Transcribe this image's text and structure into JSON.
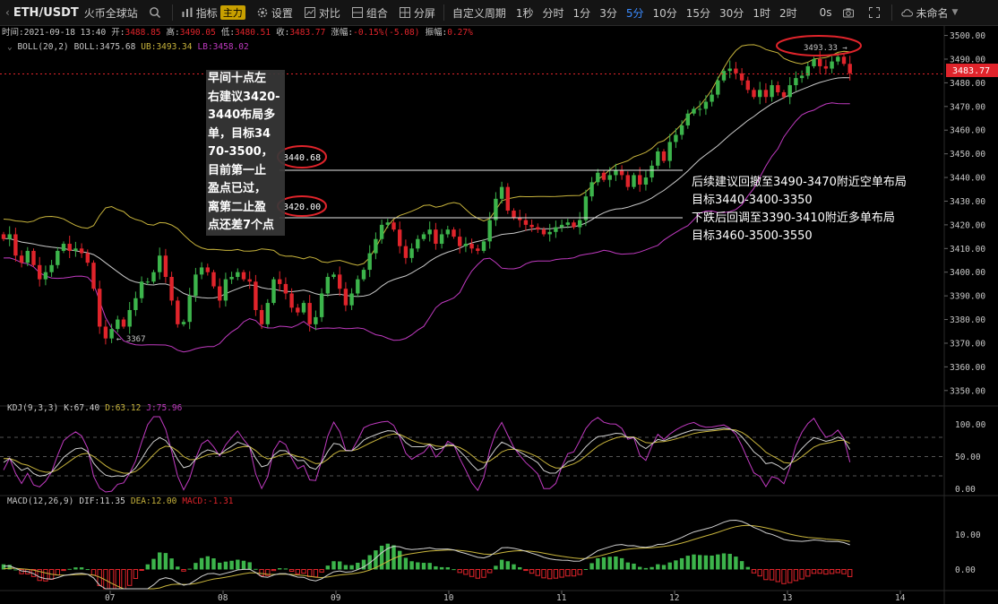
{
  "toolbar": {
    "symbol": "ETH/USDT",
    "exchange": "火币全球站",
    "indicator": "指标",
    "indicator_tag": "主力",
    "settings": "设置",
    "compare": "对比",
    "combine": "组合",
    "split": "分屏",
    "custom_period": "自定义周期",
    "periods": [
      "1秒",
      "分时",
      "1分",
      "3分",
      "5分",
      "10分",
      "15分",
      "30分",
      "1时",
      "2时"
    ],
    "active_period": "5分",
    "countdown": "0s",
    "layout_name": "未命名",
    "icons": [
      "search-icon",
      "indicator-icon",
      "settings-icon",
      "compare-icon",
      "combine-icon",
      "split-icon",
      "camera-icon",
      "fullscreen-icon",
      "cloud-icon"
    ]
  },
  "ohlc_bar": {
    "time_label": "时间:",
    "time": "2021-09-18 13:40",
    "open_label": "开:",
    "open": "3488.85",
    "high_label": "高:",
    "high": "3490.05",
    "low_label": "低:",
    "low": "3480.51",
    "close_label": "收:",
    "close": "3483.77",
    "change_label": "涨幅:",
    "change": "-0.15%(-5.08)",
    "amplitude_label": "振幅:",
    "amplitude": "0.27%"
  },
  "boll_legend": {
    "name": "BOLL(20,2)",
    "boll": "BOLL:3475.68",
    "ub": "UB:3493.34",
    "lb": "LB:3458.02"
  },
  "kdj_legend": {
    "name": "KDJ(9,3,3)",
    "k": "K:67.40",
    "d": "D:63.12",
    "j": "J:75.96"
  },
  "macd_legend": {
    "name": "MACD(12,26,9)",
    "dif": "DIF:11.35",
    "dea": "DEA:12.00",
    "macd": "MACD:-1.31"
  },
  "annotations": {
    "left_note": [
      "早间十点左",
      "右建议3420-",
      "3440布局多",
      "单，目标34",
      "70-3500，",
      "目前第一止",
      "盈点已过，",
      "离第二止盈",
      "点还差7个点"
    ],
    "right_note_1": [
      "后续建议回撤至3490-3470附近空单布局",
      "目标3440-3400-3350"
    ],
    "right_note_2": [
      "下跌后回调至3390-3410附近多单布局",
      "目标3460-3500-3550"
    ],
    "level_labels": [
      "3440.68",
      "3420.00"
    ],
    "high_label": "3493.33",
    "low_label": "3367",
    "current_price": "3483.77"
  },
  "colors": {
    "up": "#3cb44b",
    "down": "#e0242b",
    "boll_mid": "#c9c9c9",
    "boll_ub": "#c8b43c",
    "boll_lb": "#c03ac0",
    "kdj_k": "#d0d0d0",
    "kdj_d": "#c8b43c",
    "kdj_j": "#c03ac0",
    "highlight": "#e0242b",
    "accent": "#3b8bff"
  },
  "chart_data": [
    {
      "type": "candlestick",
      "title": "ETH/USDT 5分",
      "x_tick_labels": [
        "07",
        "08",
        "09",
        "10",
        "11",
        "12",
        "13",
        "14"
      ],
      "y_tick_labels": [
        "3500.00",
        "3490.00",
        "3480.00",
        "3470.00",
        "3460.00",
        "3450.00",
        "3440.00",
        "3430.00",
        "3420.00",
        "3410.00",
        "3400.00",
        "3390.00",
        "3380.00",
        "3370.00",
        "3360.00",
        "3350.00"
      ],
      "ylim": [
        3345,
        3504
      ],
      "closes": [
        3414,
        3416,
        3407,
        3404,
        3409,
        3403,
        3397,
        3400,
        3403,
        3409,
        3412,
        3409,
        3410,
        3408,
        3404,
        3393,
        3377,
        3372,
        3376,
        3380,
        3377,
        3384,
        3389,
        3396,
        3396,
        3400,
        3407,
        3398,
        3388,
        3378,
        3379,
        3390,
        3399,
        3402,
        3400,
        3394,
        3388,
        3397,
        3398,
        3400,
        3397,
        3396,
        3384,
        3378,
        3387,
        3397,
        3395,
        3391,
        3385,
        3383,
        3387,
        3378,
        3381,
        3391,
        3398,
        3399,
        3393,
        3386,
        3391,
        3397,
        3401,
        3408,
        3414,
        3420,
        3421,
        3418,
        3411,
        3406,
        3410,
        3414,
        3416,
        3418,
        3412,
        3416,
        3418,
        3415,
        3411,
        3412,
        3410,
        3409,
        3413,
        3422,
        3431,
        3436,
        3426,
        3423,
        3422,
        3420,
        3419,
        3418,
        3416,
        3417,
        3419,
        3420,
        3421,
        3419,
        3422,
        3432,
        3438,
        3442,
        3439,
        3441,
        3443,
        3441,
        3436,
        3441,
        3437,
        3440,
        3445,
        3451,
        3447,
        3455,
        3458,
        3462,
        3467,
        3469,
        3469,
        3472,
        3475,
        3481,
        3485,
        3486,
        3484,
        3481,
        3477,
        3474,
        3477,
        3474,
        3479,
        3476,
        3474,
        3479,
        3482,
        3483,
        3487,
        3490,
        3487,
        3486,
        3489,
        3491,
        3488,
        3484
      ],
      "candle_count": 143,
      "marked_high": 3493.33,
      "marked_low": 3367,
      "last_price": 3483.77,
      "horizontal_levels": [
        3440.68,
        3420.0
      ],
      "series": [
        {
          "name": "BOLL",
          "last": 3475.68
        },
        {
          "name": "UB",
          "last": 3493.34
        },
        {
          "name": "LB",
          "last": 3458.02
        }
      ]
    },
    {
      "type": "line",
      "title": "KDJ(9,3,3)",
      "y_tick_labels": [
        "100.00",
        "50.00",
        "0.00"
      ],
      "ylim": [
        -5,
        112
      ],
      "reference_lines": [
        80,
        50,
        20
      ],
      "series": [
        {
          "name": "K",
          "last": 67.4
        },
        {
          "name": "D",
          "last": 63.12
        },
        {
          "name": "J",
          "last": 75.96
        }
      ]
    },
    {
      "type": "bar",
      "title": "MACD(12,26,9)",
      "y_tick_labels": [
        "10.00",
        "0.00"
      ],
      "ylim": [
        -5.5,
        17
      ],
      "series": [
        {
          "name": "DIF",
          "last": 11.35
        },
        {
          "name": "DEA",
          "last": 12.0
        },
        {
          "name": "MACD",
          "last": -1.31
        }
      ]
    }
  ]
}
